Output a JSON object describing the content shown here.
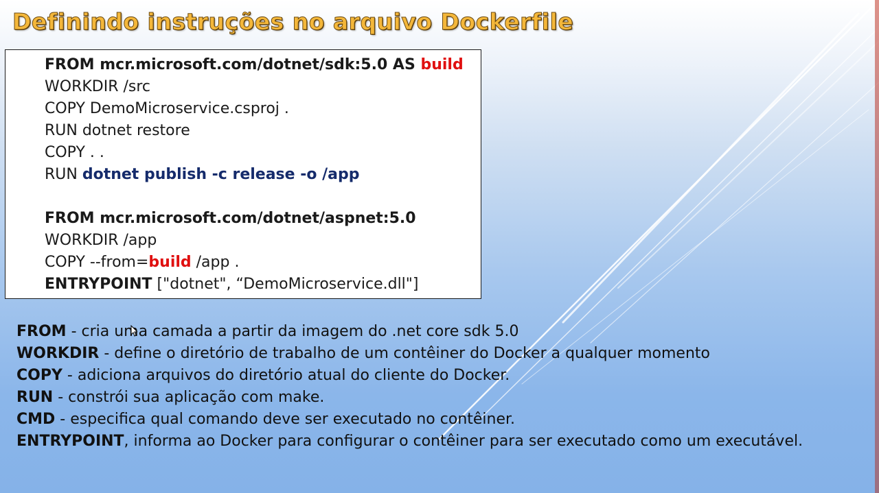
{
  "title": "Definindo instruções no arquivo Dockerfile",
  "code": {
    "line1": {
      "a": "FROM mcr.microsoft.com/dotnet/sdk:5.0 AS ",
      "b": "build"
    },
    "line2": "WORKDIR /src",
    "line3": "COPY DemoMicroservice.csproj .",
    "line4": "RUN dotnet restore",
    "line5": "COPY . .",
    "line6": {
      "a": "RUN ",
      "b": "dotnet publish -c release -o /app"
    },
    "line7": "FROM mcr.microsoft.com/dotnet/aspnet:5.0",
    "line8": "WORKDIR /app",
    "line9": {
      "a": "COPY --from=",
      "b": "build",
      "c": " /app ."
    },
    "line10": {
      "a": "ENTRYPOINT",
      "b": " [\"dotnet\", “DemoMicroservice.dll\"]"
    }
  },
  "descriptions": [
    {
      "keyword": "FROM",
      "text": "  - cria uma camada a partir da imagem do .net core sdk 5.0"
    },
    {
      "keyword": "WORKDIR",
      "text": " - define o diretório de trabalho de um contêiner do Docker a qualquer momento"
    },
    {
      "keyword": "COPY",
      "text": " - adiciona arquivos do diretório atual do cliente do Docker."
    },
    {
      "keyword": "RUN",
      "text": " - constrói sua aplicação com make."
    },
    {
      "keyword": "CMD",
      "text": " - especifica qual comando deve ser executado no contêiner."
    },
    {
      "keyword": "ENTRYPOINT",
      "text": ", informa ao Docker para configurar o contêiner para ser executado como um executável."
    }
  ],
  "colors": {
    "title": "#f4b73a",
    "highlight_red": "#e01010",
    "highlight_navy": "#152b6b"
  }
}
